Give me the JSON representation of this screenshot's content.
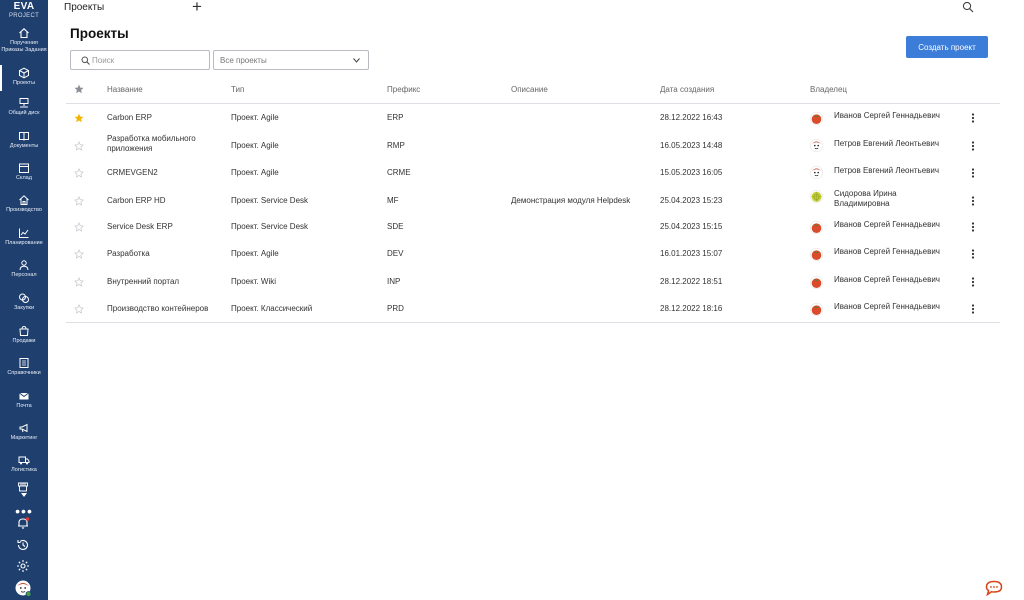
{
  "brand": {
    "line1": "EVA",
    "line2": "PROJECT"
  },
  "sidebar": {
    "items": [
      {
        "label": "Поручения Приказы Задания",
        "icon": "home-icon"
      },
      {
        "label": "Проекты",
        "icon": "cube-icon"
      },
      {
        "label": "Общий диск",
        "icon": "network-drive-icon"
      },
      {
        "label": "Документы",
        "icon": "book-icon"
      },
      {
        "label": "Склад",
        "icon": "box-icon"
      },
      {
        "label": "Производство",
        "icon": "factory-icon"
      },
      {
        "label": "Планирование",
        "icon": "chart-icon"
      },
      {
        "label": "Персонал",
        "icon": "person-icon"
      },
      {
        "label": "Закупки",
        "icon": "coins-icon"
      },
      {
        "label": "Продажи",
        "icon": "bag-icon"
      },
      {
        "label": "Справочники",
        "icon": "reference-book-icon"
      },
      {
        "label": "Почта",
        "icon": "mail-icon"
      },
      {
        "label": "Маркетинг",
        "icon": "megaphone-icon"
      },
      {
        "label": "Логистика",
        "icon": "truck-icon"
      }
    ],
    "bottom_icons": [
      "store-icon",
      "more-icon",
      "notifications-bell-icon",
      "history-icon",
      "settings-gear-icon",
      "user-avatar-icon"
    ]
  },
  "topbar": {
    "title": "Проекты",
    "add_icon": "plus-icon",
    "search_icon": "search-icon"
  },
  "page": {
    "title": "Проекты",
    "create_button": "Создать проект"
  },
  "filters": {
    "search_placeholder": "Поиск",
    "project_select": "Все проекты"
  },
  "colors": {
    "sidebar": "#1f3f6f",
    "accent": "#3b7dd8",
    "favorite_star": "#f5b400"
  },
  "table": {
    "headers": {
      "name": "Название",
      "type": "Тип",
      "prefix": "Префикс",
      "description": "Описание",
      "created": "Дата создания",
      "owner": "Владелец"
    },
    "rows": [
      {
        "favorite": true,
        "name": "Carbon ERP",
        "type": "Проект. Agile",
        "prefix": "ERP",
        "description": "",
        "created": "28.12.2022 16:43",
        "owner": "Иванов Сергей Геннадьевич",
        "owner_avatar": "tomato"
      },
      {
        "favorite": false,
        "name": "Разработка мобильного приложения",
        "type": "Проект. Agile",
        "prefix": "RMP",
        "description": "",
        "created": "16.05.2023 14:48",
        "owner": "Петров Евгений Леонтьевич",
        "owner_avatar": "face"
      },
      {
        "favorite": false,
        "name": "CRMEVGEN2",
        "type": "Проект. Agile",
        "prefix": "CRME",
        "description": "",
        "created": "15.05.2023 16:05",
        "owner": "Петров Евгений Леонтьевич",
        "owner_avatar": "face"
      },
      {
        "favorite": false,
        "name": "Carbon ERP HD",
        "type": "Проект. Service Desk",
        "prefix": "MF",
        "description": "Демонстрация модуля Helpdesk",
        "created": "25.04.2023 15:23",
        "owner": "Сидорова Ирина Владимировна",
        "owner_avatar": "lime"
      },
      {
        "favorite": false,
        "name": "Service Desk ERP",
        "type": "Проект. Service Desk",
        "prefix": "SDE",
        "description": "",
        "created": "25.04.2023 15:15",
        "owner": "Иванов Сергей Геннадьевич",
        "owner_avatar": "tomato"
      },
      {
        "favorite": false,
        "name": "Разработка",
        "type": "Проект. Agile",
        "prefix": "DEV",
        "description": "",
        "created": "16.01.2023 15:07",
        "owner": "Иванов Сергей Геннадьевич",
        "owner_avatar": "tomato"
      },
      {
        "favorite": false,
        "name": "Внутренний портал",
        "type": "Проект. Wiki",
        "prefix": "INP",
        "description": "",
        "created": "28.12.2022 18:51",
        "owner": "Иванов Сергей Геннадьевич",
        "owner_avatar": "tomato"
      },
      {
        "favorite": false,
        "name": "Производство контейнеров",
        "type": "Проект. Классический",
        "prefix": "PRD",
        "description": "",
        "created": "28.12.2022 18:16",
        "owner": "Иванов Сергей Геннадьевич",
        "owner_avatar": "tomato"
      }
    ]
  },
  "chat_icon": "chat-bubble-icon"
}
